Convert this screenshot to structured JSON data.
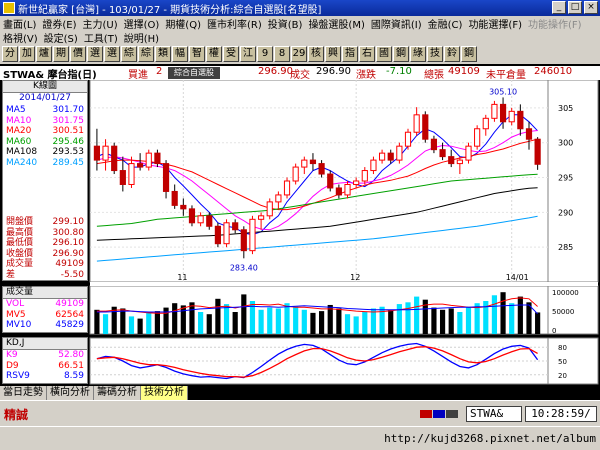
{
  "window": {
    "title": "新世紀贏家 [台灣] - 103/01/27 - 期貨技術分析:綜合自選股[名望股]",
    "buttons": [
      "_",
      "□",
      "×"
    ]
  },
  "menu": {
    "row1": [
      "畫面(L)",
      "證券(E)",
      "主力(U)",
      "選擇(O)",
      "期權(Q)",
      "匯市利率(R)",
      "投資(B)",
      "操盤選股(M)",
      "國際資訊(I)",
      "金融(C)",
      "功能選擇(F)"
    ],
    "row1_disabled": "功能操作(F)",
    "row2": [
      "格視(V)",
      "設定(S)",
      "工具(T)",
      "說明(H)"
    ]
  },
  "toolbar": [
    "分",
    "加",
    "爐",
    "期",
    "價",
    "選",
    "選",
    "綜",
    "綜",
    "類",
    "幅",
    "智",
    "權",
    "受",
    "江",
    "9",
    "8",
    "29",
    "核",
    "興",
    "指",
    "右",
    "國",
    "鋼",
    "綠",
    "技",
    "鈴",
    "鋼"
  ],
  "quote": {
    "symbol": "STWA& 摩台指(日)",
    "bid_label": "買進",
    "bid_value": "2",
    "tooltip": "綜合自選股",
    "ask_value": "296.90",
    "trade_label": "成交",
    "trade_value": "296.90",
    "change_label": "漲跌",
    "change_value": "-7.10",
    "volume_label": "總張",
    "volume_value": "49109",
    "oi_label": "未平倉量",
    "oi_value": "246010"
  },
  "indicators": {
    "title": "K線圖",
    "date": "2014/01/27",
    "ma": [
      {
        "name": "MA5",
        "value": "301.70",
        "color": "#0000ff"
      },
      {
        "name": "MA10",
        "value": "301.75",
        "color": "#ff00ff"
      },
      {
        "name": "MA20",
        "value": "300.51",
        "color": "#ff0000"
      },
      {
        "name": "MA60",
        "value": "295.46",
        "color": "#00a000"
      },
      {
        "name": "MA108",
        "value": "293.53",
        "color": "#000000"
      },
      {
        "name": "MA240",
        "value": "289.45",
        "color": "#00a0ff"
      }
    ],
    "ohlc": [
      {
        "name": "開盤價",
        "value": "299.10"
      },
      {
        "name": "最高價",
        "value": "300.80"
      },
      {
        "name": "最低價",
        "value": "296.10"
      },
      {
        "name": "收盤價",
        "value": "296.90"
      },
      {
        "name": "成交量",
        "value": "49109"
      },
      {
        "name": "差",
        "value": "-5.50"
      }
    ]
  },
  "volume_panel": {
    "title": "成交量",
    "rows": [
      {
        "name": "VOL",
        "value": "49109",
        "color": "#ff00ff"
      },
      {
        "name": "MV5",
        "value": "62564",
        "color": "#ff0000"
      },
      {
        "name": "MV10",
        "value": "45829",
        "color": "#0000ff"
      }
    ],
    "axis": [
      "100000",
      "50000",
      "0"
    ]
  },
  "kd_panel": {
    "title": "KD,J",
    "rows": [
      {
        "name": "K9",
        "value": "52.80",
        "color": "#ff00ff"
      },
      {
        "name": "D9",
        "value": "66.51",
        "color": "#ff0000"
      },
      {
        "name": "RSV9",
        "value": "8.59",
        "color": "#0000ff"
      }
    ],
    "axis": [
      "80",
      "50",
      "20"
    ]
  },
  "price_axis": [
    "305",
    "300",
    "295",
    "290",
    "285"
  ],
  "date_axis": [
    "11",
    "12",
    "14/01"
  ],
  "annotations": {
    "high": "305.10",
    "low": "283.40"
  },
  "tabs": [
    "當日走勢",
    "橫向分析",
    "籌碼分析",
    "技術分析"
  ],
  "status": {
    "mode": "精誠",
    "symbol": "STWA&",
    "time": "10:28:59/"
  },
  "taskbar": {
    "url": "http://kujd3268.pixnet.net/album"
  },
  "chart_data": {
    "type": "candlestick",
    "price_range": [
      280,
      309
    ],
    "candles": [
      [
        299.5,
        302,
        296,
        297.5
      ],
      [
        297.5,
        300.5,
        296,
        299.5
      ],
      [
        299.5,
        300,
        295.5,
        296
      ],
      [
        296,
        298,
        293,
        294
      ],
      [
        294,
        298,
        293.5,
        297
      ],
      [
        297,
        298.5,
        296,
        296.5
      ],
      [
        296.5,
        299,
        296,
        298.5
      ],
      [
        298.5,
        299,
        296.5,
        297
      ],
      [
        297,
        297.5,
        292,
        293
      ],
      [
        293,
        294,
        290.5,
        291
      ],
      [
        291,
        292,
        289.5,
        290.5
      ],
      [
        290.5,
        291,
        288,
        288.5
      ],
      [
        288.5,
        290,
        288,
        289.5
      ],
      [
        289.5,
        290,
        287.5,
        288
      ],
      [
        288,
        288.5,
        285,
        285.5
      ],
      [
        285.5,
        289,
        285,
        288.5
      ],
      [
        288.5,
        289,
        287,
        287.5
      ],
      [
        287.5,
        288,
        283.4,
        284.5
      ],
      [
        284.5,
        289.5,
        284,
        289
      ],
      [
        289,
        290,
        287.5,
        289.5
      ],
      [
        289.5,
        292,
        289,
        291.5
      ],
      [
        291.5,
        293,
        290.5,
        292.5
      ],
      [
        292.5,
        295,
        292,
        294.5
      ],
      [
        294.5,
        297,
        294,
        296.5
      ],
      [
        296.5,
        298,
        295.5,
        297.5
      ],
      [
        297.5,
        298.5,
        296,
        297
      ],
      [
        297,
        297.5,
        295,
        295.5
      ],
      [
        295.5,
        296,
        293,
        293.5
      ],
      [
        293.5,
        294,
        292,
        292.5
      ],
      [
        292.5,
        294.5,
        292,
        294
      ],
      [
        294,
        295,
        293.5,
        294.5
      ],
      [
        294.5,
        296.5,
        294,
        296
      ],
      [
        296,
        298,
        295.5,
        297.5
      ],
      [
        297.5,
        299,
        297,
        298.5
      ],
      [
        298.5,
        299,
        297,
        297.5
      ],
      [
        297.5,
        300,
        297,
        299.5
      ],
      [
        299.5,
        302,
        299,
        301.5
      ],
      [
        301.5,
        305.1,
        301,
        304
      ],
      [
        304,
        304.5,
        300,
        300.5
      ],
      [
        300.5,
        301,
        298.5,
        299
      ],
      [
        299,
        300,
        297.5,
        298
      ],
      [
        298,
        299,
        296.5,
        297
      ],
      [
        297,
        298,
        295.5,
        297.5
      ],
      [
        297.5,
        300,
        297,
        299.5
      ],
      [
        299.5,
        302.5,
        299,
        302
      ],
      [
        302,
        304,
        301,
        303.5
      ],
      [
        303.5,
        306,
        303,
        305.5
      ],
      [
        305.5,
        306.5,
        302,
        303
      ],
      [
        303,
        305,
        302.5,
        304.5
      ],
      [
        304.5,
        305.5,
        301,
        302
      ],
      [
        302,
        303,
        299,
        300.5
      ],
      [
        300.5,
        300.8,
        296.1,
        296.9
      ]
    ],
    "ma_series": {
      "MA5": [
        298,
        298.5,
        298,
        297.5,
        296.5,
        296.5,
        297,
        297.2,
        296.5,
        295,
        293.8,
        292.5,
        291.2,
        290,
        288.5,
        288,
        287.8,
        287,
        286.8,
        287.2,
        288.5,
        289.5,
        291.5,
        293,
        294.5,
        296,
        296.5,
        296,
        295.2,
        294.5,
        294,
        293.7,
        294.5,
        296,
        297,
        298,
        299.5,
        301,
        302,
        301.5,
        300.5,
        299.3,
        298,
        297.8,
        298.5,
        299.8,
        301.5,
        303,
        304,
        304,
        303,
        301.7
      ],
      "MA10": [
        297.5,
        297.8,
        298,
        297.8,
        297.5,
        297.2,
        296.8,
        296.6,
        296.4,
        296,
        295.3,
        294.5,
        293.5,
        292.5,
        291.5,
        290.5,
        289.5,
        288.8,
        288,
        287.6,
        287.5,
        288,
        288.8,
        289.8,
        291,
        292.3,
        293.3,
        294,
        294.2,
        294.3,
        294.2,
        294.2,
        294.5,
        294.8,
        295.3,
        296,
        296.8,
        297.8,
        298.8,
        299.3,
        299.6,
        299.5,
        299.2,
        298.9,
        298.7,
        298.8,
        299.3,
        300,
        300.8,
        301.3,
        301.6,
        301.75
      ],
      "MA20": [
        297,
        297.2,
        297.4,
        297.5,
        297.5,
        297.4,
        297.3,
        297.1,
        296.9,
        296.6,
        296.2,
        295.8,
        295.2,
        294.6,
        294,
        293.4,
        292.8,
        292.2,
        291.6,
        291,
        290.6,
        290.4,
        290.4,
        290.6,
        290.9,
        291.3,
        291.7,
        292.1,
        292.6,
        293.1,
        293.5,
        293.9,
        294.2,
        294.4,
        294.6,
        294.9,
        295.2,
        295.7,
        296.3,
        296.8,
        297.2,
        297.5,
        297.8,
        298,
        298.3,
        298.5,
        298.8,
        299.1,
        299.5,
        299.9,
        300.2,
        300.51
      ],
      "MA60": [
        288,
        288.1,
        288.2,
        288.3,
        288.4,
        288.6,
        288.8,
        289,
        289.1,
        289.2,
        289.3,
        289.4,
        289.5,
        289.6,
        289.7,
        289.8,
        289.9,
        290,
        290.1,
        290.2,
        290.3,
        290.5,
        290.7,
        290.9,
        291.1,
        291.3,
        291.5,
        291.7,
        291.9,
        292.1,
        292.3,
        292.5,
        292.7,
        292.9,
        293.1,
        293.3,
        293.5,
        293.7,
        293.9,
        294.1,
        294.3,
        294.5,
        294.6,
        294.7,
        294.8,
        294.9,
        295,
        295.1,
        295.2,
        295.3,
        295.4,
        295.46
      ],
      "MA108": [
        286,
        286.05,
        286.1,
        286.15,
        286.2,
        286.25,
        286.3,
        286.35,
        286.4,
        286.45,
        286.5,
        286.55,
        286.6,
        286.65,
        286.7,
        286.8,
        286.9,
        287,
        287.1,
        287.2,
        287.3,
        287.4,
        287.5,
        287.6,
        287.7,
        287.8,
        287.9,
        288,
        288.2,
        288.4,
        288.6,
        288.8,
        289,
        289.2,
        289.4,
        289.6,
        289.8,
        290,
        290.3,
        290.6,
        290.9,
        291.2,
        291.5,
        291.8,
        292.1,
        292.4,
        292.7,
        292.9,
        293.1,
        293.3,
        293.45,
        293.53
      ],
      "MA240": [
        283,
        283.1,
        283.2,
        283.3,
        283.4,
        283.5,
        283.6,
        283.7,
        283.8,
        283.9,
        284,
        284.1,
        284.2,
        284.3,
        284.4,
        284.5,
        284.6,
        284.7,
        284.8,
        284.9,
        285,
        285.1,
        285.2,
        285.3,
        285.4,
        285.5,
        285.6,
        285.7,
        285.8,
        285.9,
        286,
        286.1,
        286.2,
        286.35,
        286.5,
        286.65,
        286.8,
        286.95,
        287.1,
        287.25,
        287.4,
        287.55,
        287.7,
        287.85,
        288,
        288.2,
        288.4,
        288.6,
        288.8,
        289,
        289.2,
        289.45
      ]
    },
    "volume": [
      55,
      45,
      62,
      58,
      40,
      35,
      48,
      52,
      60,
      70,
      65,
      72,
      50,
      45,
      80,
      68,
      50,
      90,
      75,
      55,
      60,
      58,
      70,
      62,
      55,
      48,
      52,
      66,
      58,
      45,
      40,
      50,
      58,
      62,
      55,
      68,
      72,
      85,
      78,
      60,
      55,
      58,
      50,
      62,
      70,
      75,
      88,
      95,
      70,
      85,
      72,
      49
    ],
    "volume_max": 100000,
    "mv5": [
      52,
      52,
      54,
      55,
      52,
      50,
      48,
      47,
      47,
      53,
      59,
      64,
      63,
      60,
      62,
      63,
      59,
      63,
      67,
      67,
      66,
      68,
      63,
      61,
      61,
      59,
      57,
      57,
      56,
      54,
      52,
      51,
      50,
      51,
      53,
      55,
      58,
      62,
      66,
      68,
      68,
      65,
      63,
      61,
      60,
      62,
      68,
      75,
      80,
      82,
      80,
      62.5
    ],
    "mv10": [
      50,
      50,
      51,
      52,
      52,
      51,
      50,
      50,
      50,
      51,
      53,
      55,
      57,
      58,
      59,
      60,
      61,
      62,
      63,
      62,
      62,
      61,
      62,
      63,
      64,
      63,
      62,
      61,
      60,
      58,
      57,
      56,
      55,
      55,
      55,
      55,
      55,
      56,
      57,
      58,
      59,
      60,
      61,
      61,
      62,
      62,
      63,
      64,
      65,
      66,
      66,
      45.8
    ],
    "kd_k": [
      55,
      60,
      58,
      50,
      40,
      35,
      38,
      42,
      36,
      28,
      22,
      18,
      15,
      16,
      14,
      12,
      16,
      14,
      25,
      38,
      52,
      65,
      75,
      82,
      86,
      84,
      76,
      64,
      52,
      44,
      42,
      48,
      58,
      68,
      76,
      82,
      86,
      88,
      82,
      72,
      60,
      48,
      38,
      35,
      42,
      54,
      66,
      76,
      82,
      84,
      78,
      52.8
    ],
    "kd_d": [
      55,
      57,
      58,
      55,
      50,
      45,
      42,
      42,
      40,
      36,
      31,
      27,
      23,
      20,
      18,
      16,
      16,
      15,
      18,
      25,
      34,
      44,
      55,
      64,
      72,
      77,
      77,
      72,
      65,
      57,
      52,
      50,
      53,
      58,
      64,
      70,
      75,
      80,
      81,
      78,
      72,
      64,
      55,
      48,
      46,
      49,
      55,
      63,
      70,
      76,
      77,
      66.5
    ]
  }
}
